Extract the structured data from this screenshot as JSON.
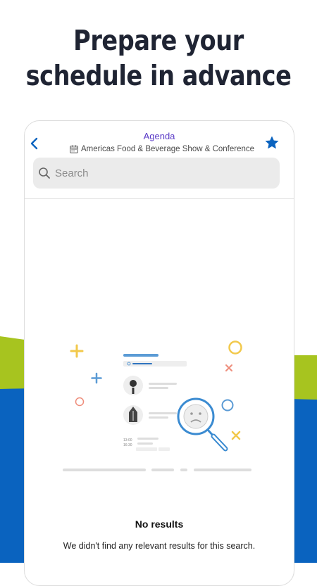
{
  "headline": "Prepare your schedule in advance",
  "header": {
    "title": "Agenda",
    "event_name": "Americas Food & Beverage Show & Conference",
    "back_icon": "chevron-left-icon",
    "favorite_icon": "star-icon"
  },
  "search": {
    "placeholder": "Search",
    "value": ""
  },
  "illustration": {
    "time_start": "13:00",
    "time_end": "16:30"
  },
  "empty_state": {
    "title": "No results",
    "description": "We didn't find any relevant results for this search."
  },
  "colors": {
    "accent_purple": "#5a3ac7",
    "brand_blue": "#0a63bf",
    "lime_green": "#a7c41f",
    "headline_text": "#1f2433"
  }
}
